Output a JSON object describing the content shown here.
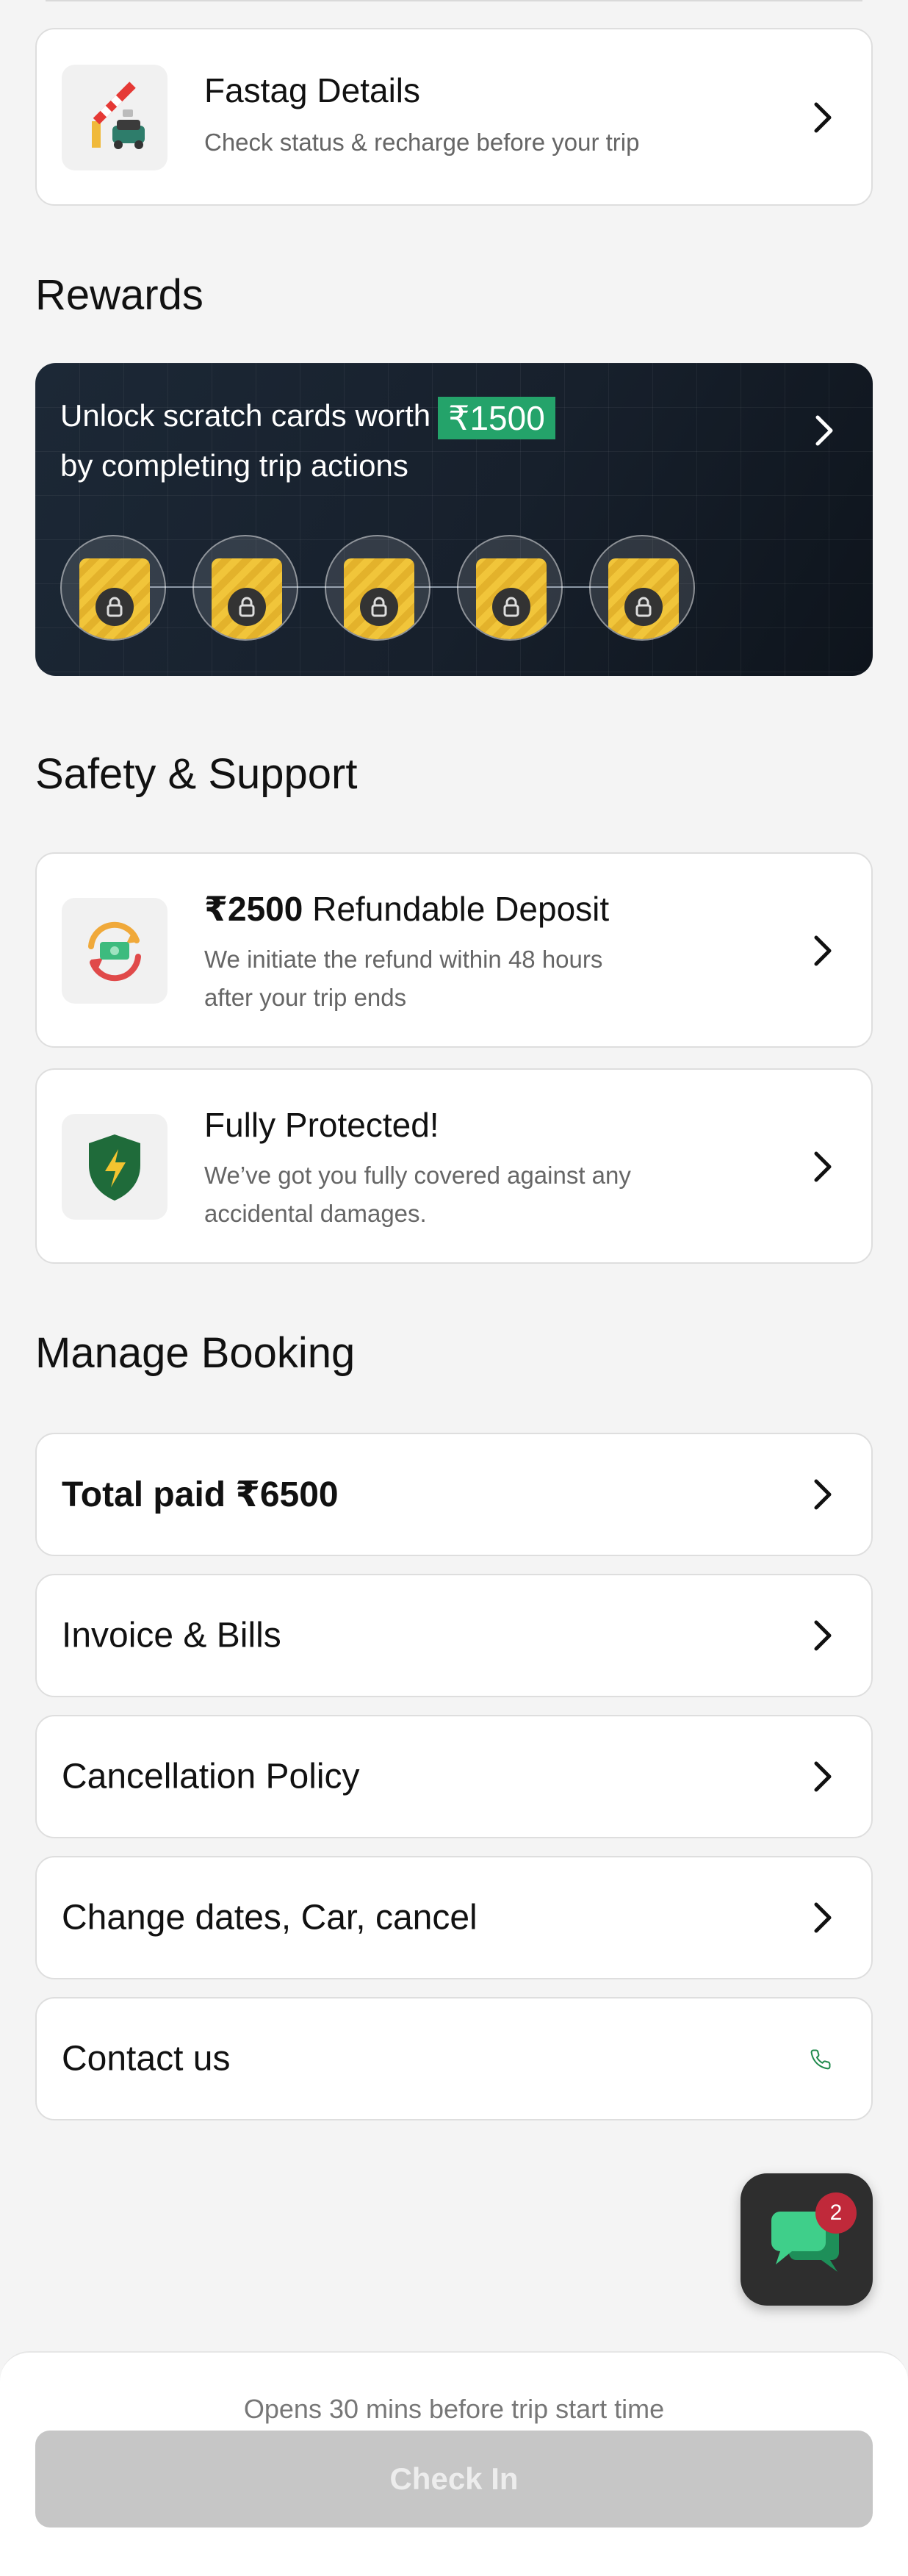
{
  "fastag": {
    "title": "Fastag Details",
    "subtitle": "Check status & recharge before your trip"
  },
  "rewards": {
    "section_title": "Rewards",
    "line1_prefix": "Unlock scratch cards worth",
    "amount": "₹1500",
    "line2": "by completing trip actions",
    "cards": 5
  },
  "safety": {
    "section_title": "Safety & Support",
    "deposit": {
      "amount": "₹2500",
      "title": "Refundable Deposit",
      "sub1": "We initiate the refund within 48 hours",
      "sub2": "after your trip ends"
    },
    "protected": {
      "title": "Fully Protected!",
      "sub1": "We’ve got you fully covered against any",
      "sub2": "accidental damages."
    }
  },
  "manage": {
    "section_title": "Manage Booking",
    "items": [
      {
        "label": "Total paid ₹6500",
        "icon": "chevron-right-icon"
      },
      {
        "label": "Invoice & Bills",
        "icon": "chevron-right-icon"
      },
      {
        "label": "Cancellation Policy",
        "icon": "chevron-right-icon"
      },
      {
        "label": "Change dates, Car, cancel",
        "icon": "chevron-right-icon"
      },
      {
        "label": "Contact us",
        "icon": "phone-icon"
      }
    ]
  },
  "chat": {
    "badge": "2"
  },
  "footer": {
    "opens_text": "Opens 30 mins before trip start time",
    "checkin_label": "Check In"
  },
  "colors": {
    "accent_green": "#24a36a",
    "phone_green": "#1f8a4c",
    "badge_red": "#c0293a",
    "disabled_button": "#c6c6c6"
  }
}
